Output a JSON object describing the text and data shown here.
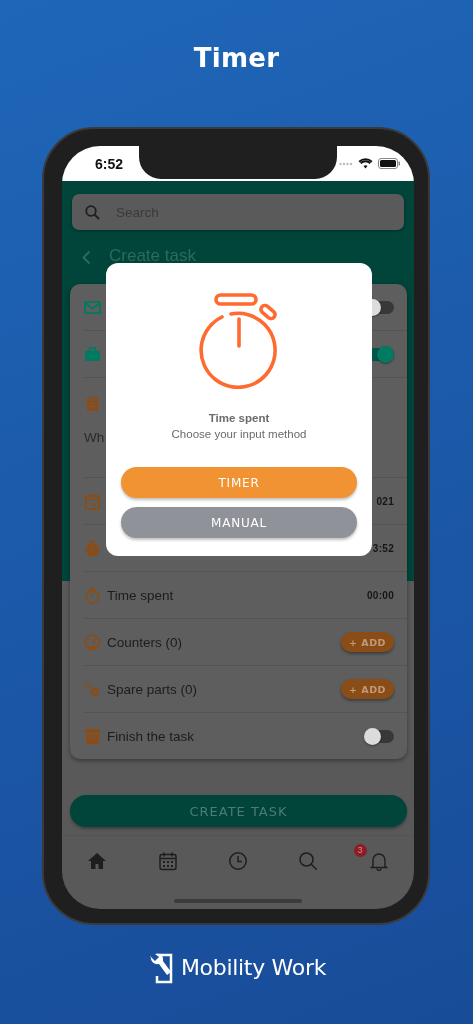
{
  "title": "Timer",
  "status_bar": {
    "time": "6:52"
  },
  "search": {
    "placeholder": "Search"
  },
  "header": {
    "title": "Create task"
  },
  "form_rows": [
    {
      "kind": "toggle",
      "on": false
    },
    {
      "kind": "toggle",
      "on": true
    },
    {
      "kind": "text_field",
      "value": "Wh"
    },
    {
      "kind": "value",
      "value": "021"
    },
    {
      "kind": "value",
      "value": "3:52"
    },
    {
      "kind": "value",
      "label": "Time spent",
      "value": "00:00"
    },
    {
      "kind": "add",
      "label": "Counters (0)",
      "action": "+ ADD"
    },
    {
      "kind": "add",
      "label": "Spare parts (0)",
      "action": "+ ADD"
    },
    {
      "kind": "toggle",
      "label": "Finish the task",
      "on": false
    }
  ],
  "create_button": "CREATE TASK",
  "nav": {
    "notification_badge": "3"
  },
  "dialog": {
    "title": "Time spent",
    "subtitle": "Choose your input method",
    "buttons": [
      {
        "label": "TIMER",
        "kind": "primary"
      },
      {
        "label": "MANUAL",
        "kind": "secondary"
      }
    ]
  },
  "brand": "Mobility Work"
}
